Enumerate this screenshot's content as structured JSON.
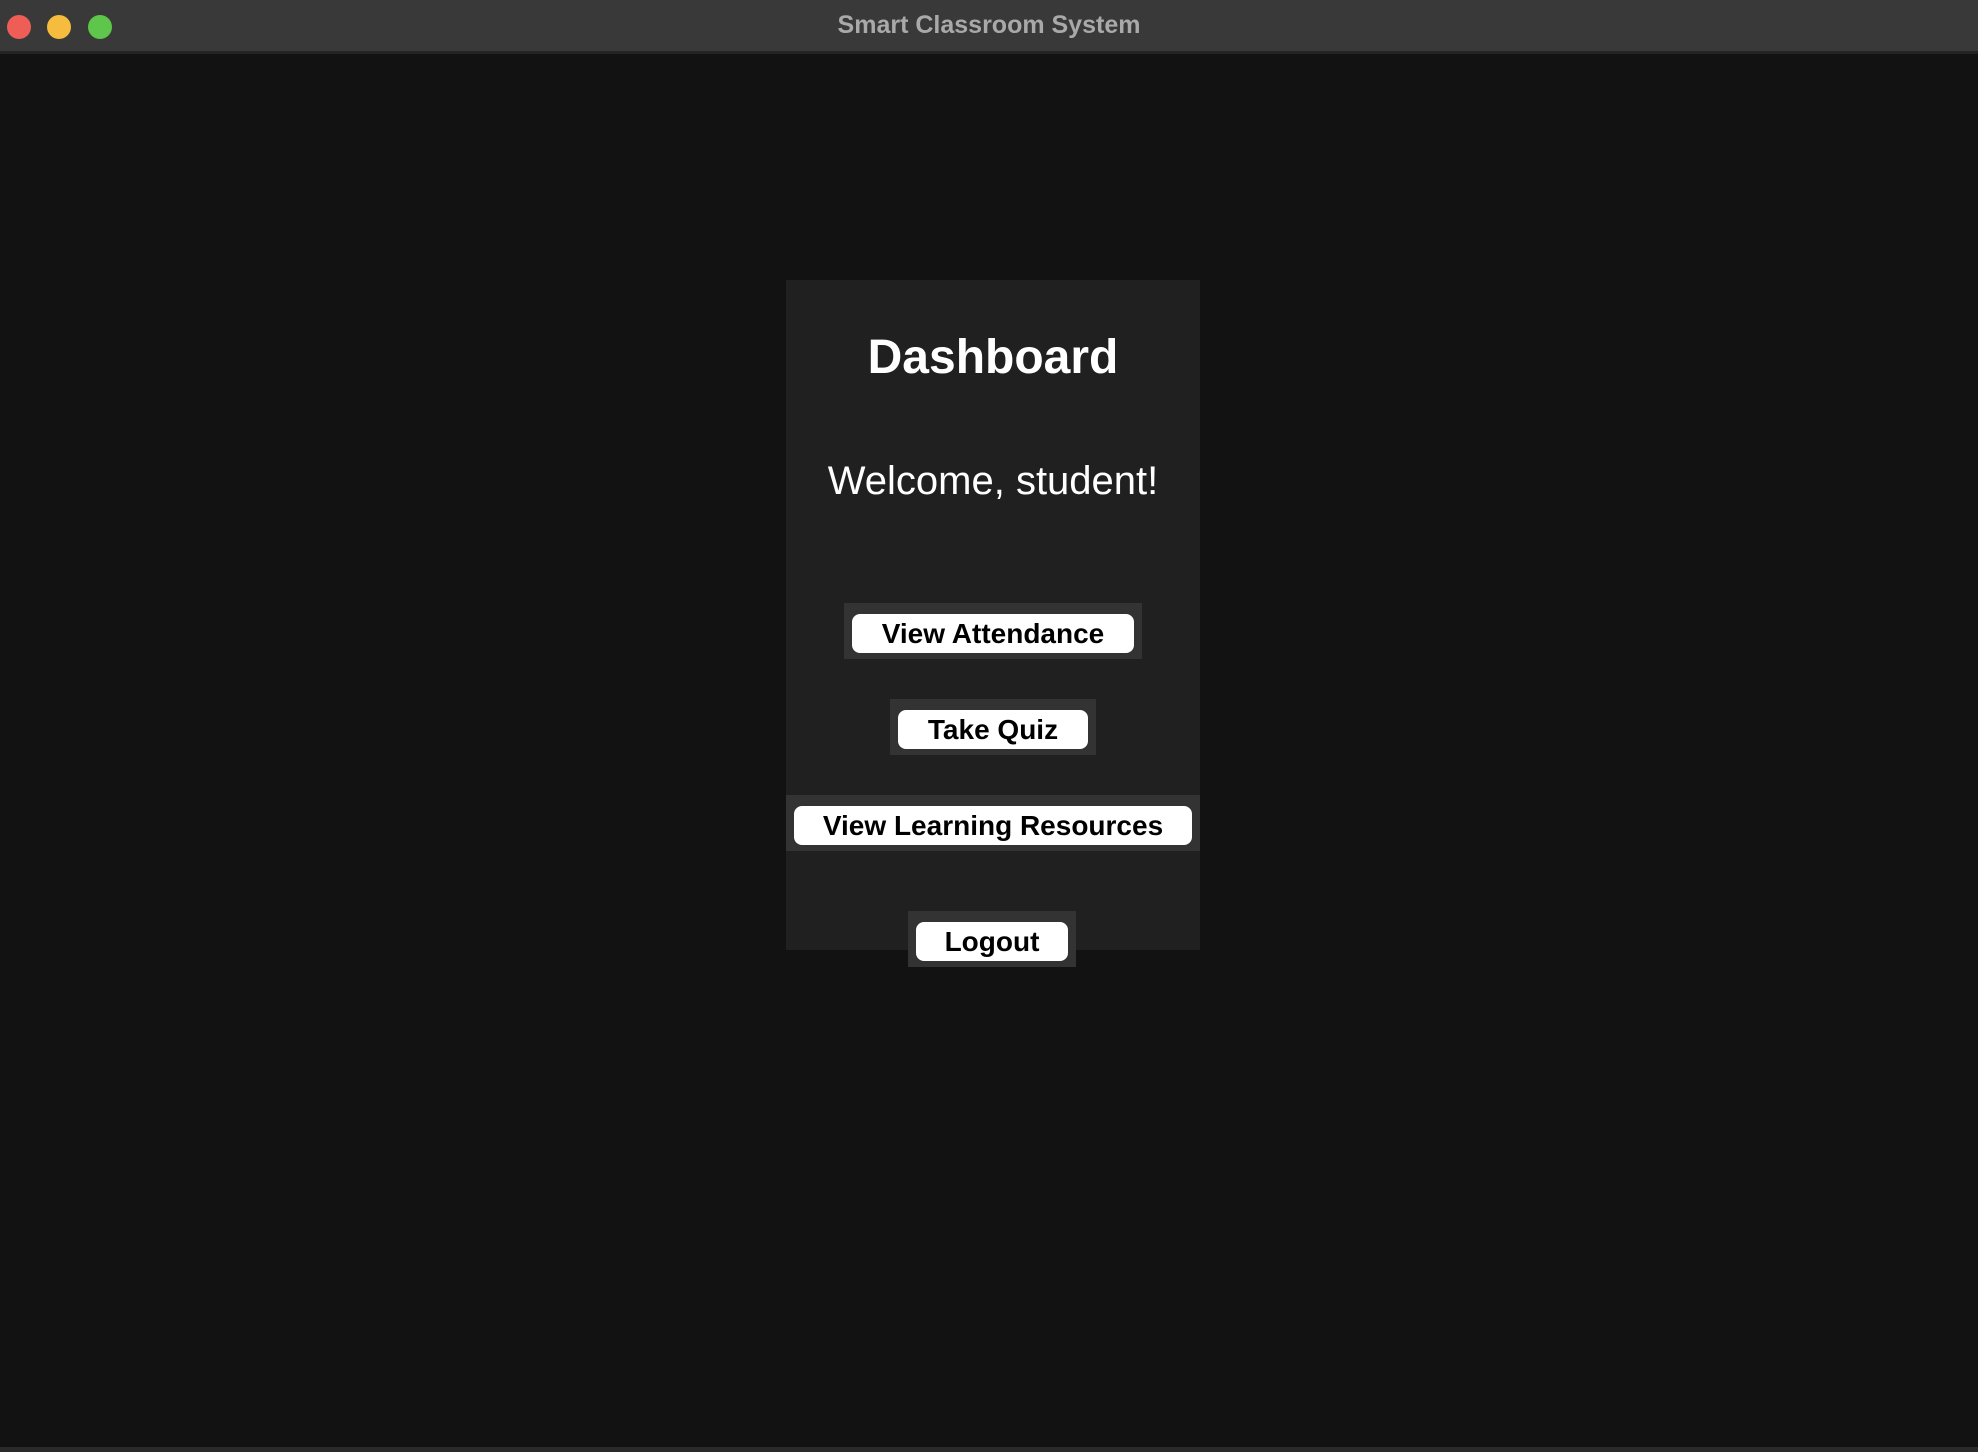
{
  "window": {
    "title": "Smart Classroom System"
  },
  "dashboard": {
    "heading": "Dashboard",
    "welcome": "Welcome, student!",
    "buttons": {
      "view_attendance": "View Attendance",
      "take_quiz": "Take Quiz",
      "view_learning_resources": "View Learning Resources",
      "logout": "Logout"
    }
  },
  "colors": {
    "background": "#121212",
    "panel": "#202020",
    "titlebar": "#393939",
    "button": "#ffffff",
    "button_text": "#000000"
  }
}
